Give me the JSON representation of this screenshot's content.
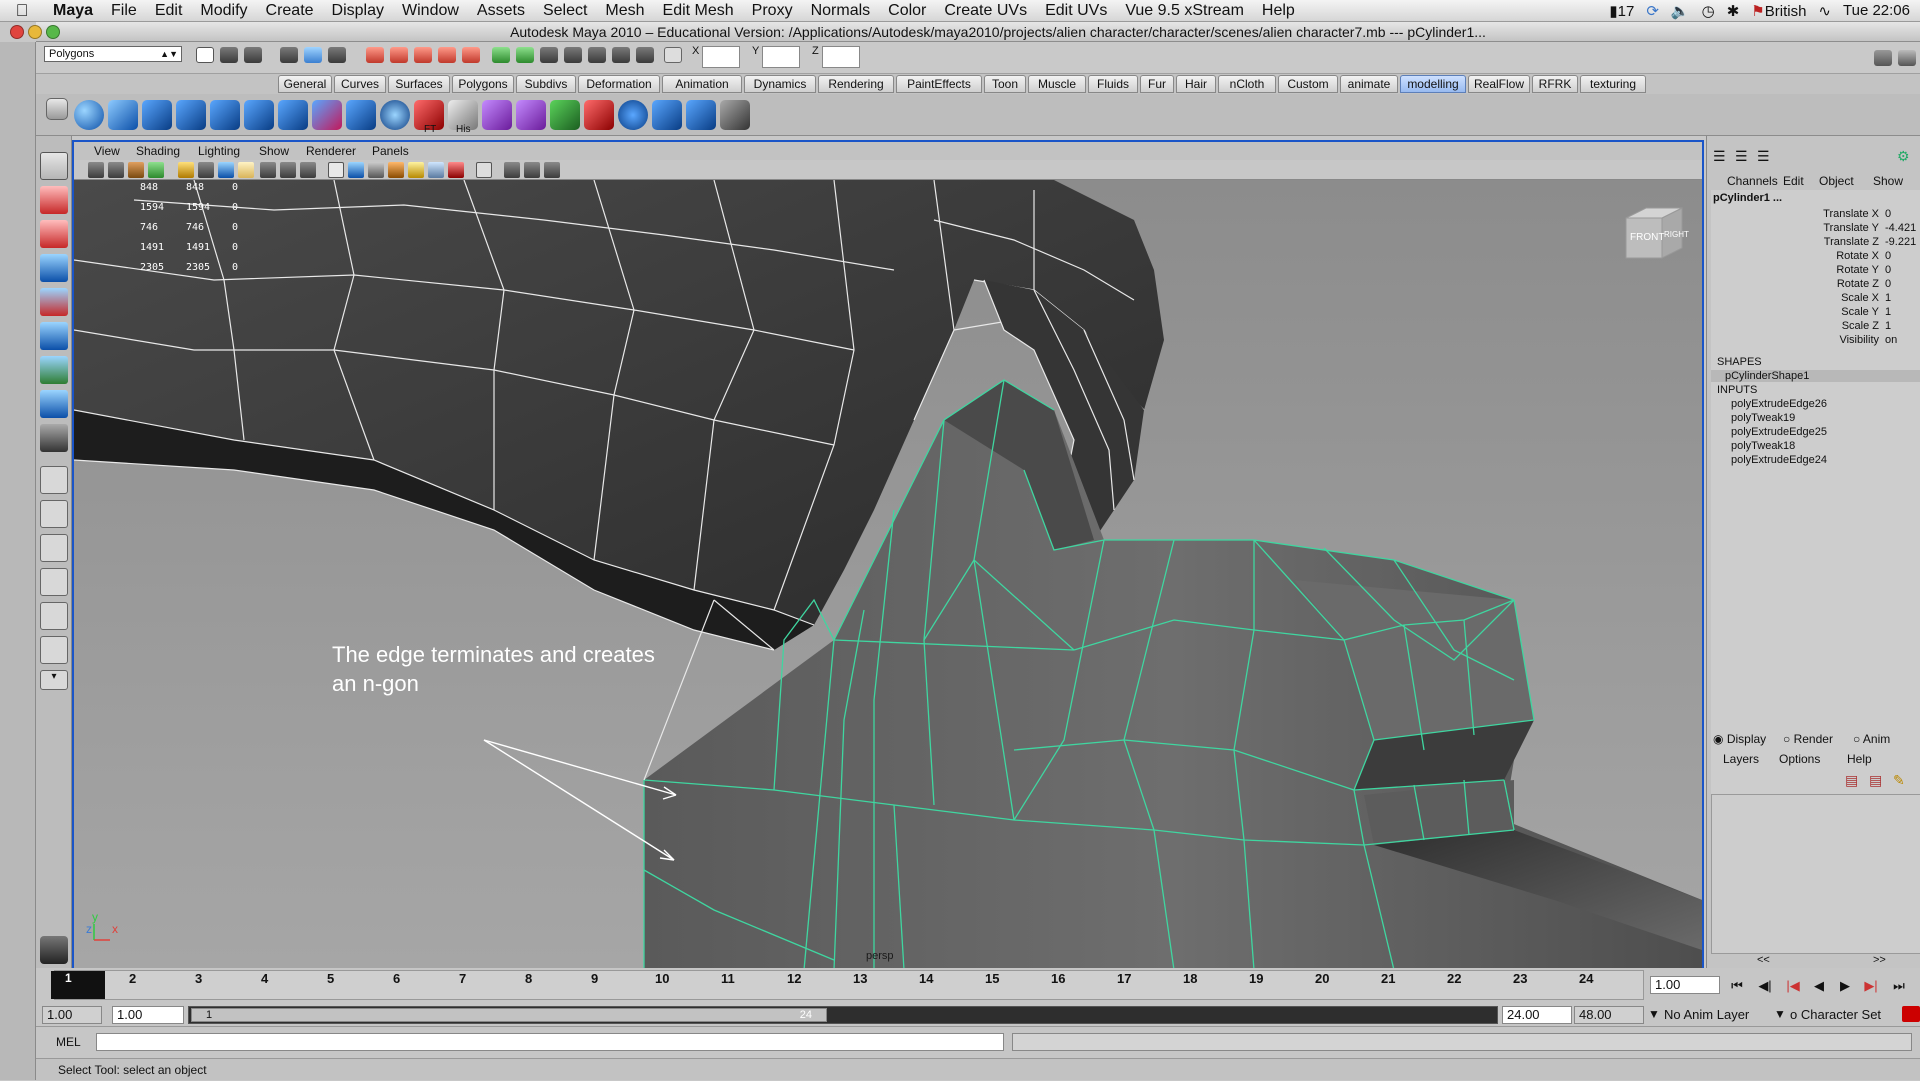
{
  "menubar": {
    "app": "Maya",
    "items": [
      "File",
      "Edit",
      "Modify",
      "Create",
      "Display",
      "Window",
      "Assets",
      "Select",
      "Mesh",
      "Edit Mesh",
      "Proxy",
      "Normals",
      "Color",
      "Create UVs",
      "Edit UVs",
      "Vue 9.5 xStream",
      "Help"
    ],
    "battery": "17",
    "input_source": "British",
    "clock": "Tue 22:06"
  },
  "window": {
    "title": "Autodesk Maya 2010 – Educational Version: /Applications/Autodesk/maya2010/projects/alien character/character/scenes/alien character7.mb   ---   pCylinder1..."
  },
  "statusline": {
    "menu_set": "Polygons",
    "x_label": "X",
    "y_label": "Y",
    "z_label": "Z"
  },
  "shelf": {
    "tabs": [
      "General",
      "Curves",
      "Surfaces",
      "Polygons",
      "Subdivs",
      "Deformation",
      "Animation",
      "Dynamics",
      "Rendering",
      "PaintEffects",
      "Toon",
      "Muscle",
      "Fluids",
      "Fur",
      "Hair",
      "nCloth",
      "Custom",
      "animate",
      "modelling",
      "RealFlow",
      "RFRK",
      "texturing"
    ],
    "active_tab": "modelling",
    "icon_labels": {
      "ft": "FT",
      "his": "His"
    }
  },
  "viewport": {
    "menu": [
      "View",
      "Shading",
      "Lighting",
      "Show",
      "Renderer",
      "Panels"
    ],
    "hud": [
      {
        "a": "848",
        "b": "848",
        "c": "0"
      },
      {
        "a": "1594",
        "b": "1594",
        "c": "0"
      },
      {
        "a": "746",
        "b": "746",
        "c": "0"
      },
      {
        "a": "1491",
        "b": "1491",
        "c": "0"
      },
      {
        "a": "2305",
        "b": "2305",
        "c": "0"
      }
    ],
    "annotation_line1": "The edge terminates and creates",
    "annotation_line2": "an n-gon",
    "camera": "persp",
    "viewcube_front": "FRONT",
    "viewcube_right": "RIGHT",
    "axis_y": "y",
    "axis_z": "z",
    "axis_x": "x"
  },
  "channelbox": {
    "menu": [
      "Channels",
      "Edit",
      "Object",
      "Show"
    ],
    "object": "pCylinder1 ...",
    "attributes": [
      {
        "name": "Translate X",
        "value": "0"
      },
      {
        "name": "Translate Y",
        "value": "-4.421"
      },
      {
        "name": "Translate Z",
        "value": "-9.221"
      },
      {
        "name": "Rotate X",
        "value": "0"
      },
      {
        "name": "Rotate Y",
        "value": "0"
      },
      {
        "name": "Rotate Z",
        "value": "0"
      },
      {
        "name": "Scale X",
        "value": "1"
      },
      {
        "name": "Scale Y",
        "value": "1"
      },
      {
        "name": "Scale Z",
        "value": "1"
      },
      {
        "name": "Visibility",
        "value": "on"
      }
    ],
    "shapes_header": "SHAPES",
    "shape": "pCylinderShape1",
    "inputs_header": "INPUTS",
    "inputs": [
      "polyExtrudeEdge26",
      "polyTweak19",
      "polyExtrudeEdge25",
      "polyTweak18",
      "polyExtrudeEdge24"
    ],
    "layer_modes": [
      "Display",
      "Render",
      "Anim"
    ],
    "layer_selected": "Display",
    "layer_menu": [
      "Layers",
      "Options",
      "Help"
    ],
    "scroll_left": "<<",
    "scroll_right": ">>"
  },
  "timeslider": {
    "ticks": [
      "1",
      "2",
      "3",
      "4",
      "5",
      "6",
      "7",
      "8",
      "9",
      "10",
      "11",
      "12",
      "13",
      "14",
      "15",
      "16",
      "17",
      "18",
      "19",
      "20",
      "21",
      "22",
      "23",
      "24"
    ],
    "current_frame": "1.00",
    "current_marker": "1"
  },
  "range": {
    "start": "1.00",
    "playback_start": "1.00",
    "slider_left": "1",
    "slider_right": "24",
    "playback_end": "24.00",
    "end": "48.00",
    "anim_layer": "No Anim Layer",
    "character_set": "o Character Set"
  },
  "cmdline": {
    "label": "MEL",
    "value": ""
  },
  "helpline": {
    "text": "Select Tool: select an object"
  }
}
